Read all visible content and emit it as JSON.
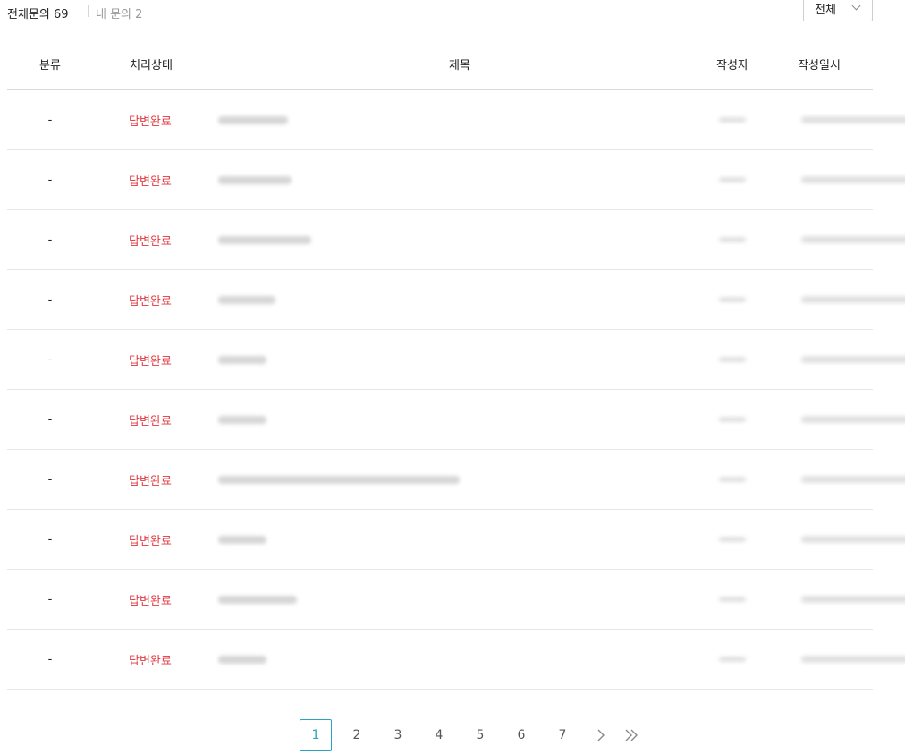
{
  "tabs": {
    "all_label": "전체문의 69",
    "mine_label": "내 문의 2"
  },
  "filter": {
    "selected": "전체"
  },
  "table": {
    "headers": {
      "category": "분류",
      "status": "처리상태",
      "title": "제목",
      "author": "작성자",
      "date": "작성일시"
    },
    "rows": [
      {
        "category": "-",
        "status": "답변완료",
        "title_blur_width": 78
      },
      {
        "category": "-",
        "status": "답변완료",
        "title_blur_width": 82
      },
      {
        "category": "-",
        "status": "답변완료",
        "title_blur_width": 104
      },
      {
        "category": "-",
        "status": "답변완료",
        "title_blur_width": 64
      },
      {
        "category": "-",
        "status": "답변완료",
        "title_blur_width": 54
      },
      {
        "category": "-",
        "status": "답변완료",
        "title_blur_width": 54
      },
      {
        "category": "-",
        "status": "답변완료",
        "title_blur_width": 270
      },
      {
        "category": "-",
        "status": "답변완료",
        "title_blur_width": 54
      },
      {
        "category": "-",
        "status": "답변완료",
        "title_blur_width": 88
      },
      {
        "category": "-",
        "status": "답변완료",
        "title_blur_width": 54
      }
    ]
  },
  "pagination": {
    "pages": [
      "1",
      "2",
      "3",
      "4",
      "5",
      "6",
      "7"
    ],
    "current": "1",
    "next_icon": "chevron-right-icon",
    "last_icon": "double-chevron-right-icon"
  },
  "colors": {
    "status_done": "#e0383e",
    "active_page": "#2aa3c2"
  }
}
